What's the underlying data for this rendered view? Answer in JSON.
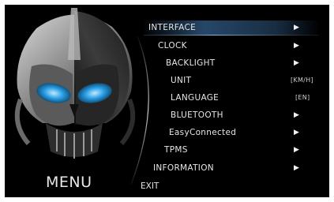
{
  "screen": {
    "title": "MENU",
    "exit_label": "EXIT"
  },
  "menu": {
    "items": [
      {
        "label": "INTERFACE",
        "value": "",
        "arrow": "▶",
        "selected": true
      },
      {
        "label": "CLOCK",
        "value": "",
        "arrow": "▶"
      },
      {
        "label": "BACKLIGHT",
        "value": "",
        "arrow": "▶"
      },
      {
        "label": "UNIT",
        "value": "[KM/H]",
        "arrow": ""
      },
      {
        "label": "LANGUAGE",
        "value": "[EN]",
        "arrow": ""
      },
      {
        "label": "BLUETOOTH",
        "value": "",
        "arrow": "▶"
      },
      {
        "label": "EasyConnected",
        "value": "",
        "arrow": "▶"
      },
      {
        "label": "TPMS",
        "value": "",
        "arrow": "▶"
      },
      {
        "label": "INFORMATION",
        "value": "",
        "arrow": "▶"
      }
    ]
  },
  "colors": {
    "background": "#000000",
    "text": "#e6e6e6",
    "highlight": "#4682be",
    "visor": "#2a9fe6"
  }
}
